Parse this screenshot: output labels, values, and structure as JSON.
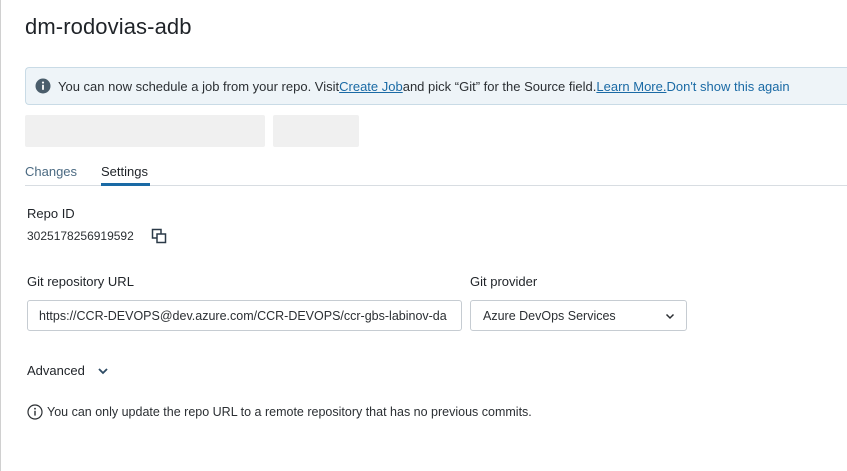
{
  "page": {
    "title": "dm-rodovias-adb"
  },
  "banner": {
    "text_before": "You can now schedule a job from your repo. Visit ",
    "create_job_link": "Create Job",
    "text_middle": " and pick “Git” for the Source field.",
    "learn_more_link": " Learn More.",
    "dismiss_link": " Don't show this again",
    "icon": "info-icon"
  },
  "tabs": [
    {
      "label": "Changes",
      "active": false
    },
    {
      "label": "Settings",
      "active": true
    }
  ],
  "repo": {
    "id_label": "Repo ID",
    "id_value": "3025178256919592",
    "copy_icon": "copy-icon"
  },
  "git": {
    "url_label": "Git repository URL",
    "url_value": "https://CCR-DEVOPS@dev.azure.com/CCR-DEVOPS/ccr-gbs-labinov-da",
    "provider_label": "Git provider",
    "provider_value": "Azure DevOps Services"
  },
  "advanced": {
    "label": "Advanced"
  },
  "note": {
    "text": "You can only update the repo URL to a remote repository that has no previous commits."
  },
  "colors": {
    "accent": "#1a6aa5",
    "banner_bg": "#eef4f8",
    "banner_icon": "#4a5d6b"
  }
}
